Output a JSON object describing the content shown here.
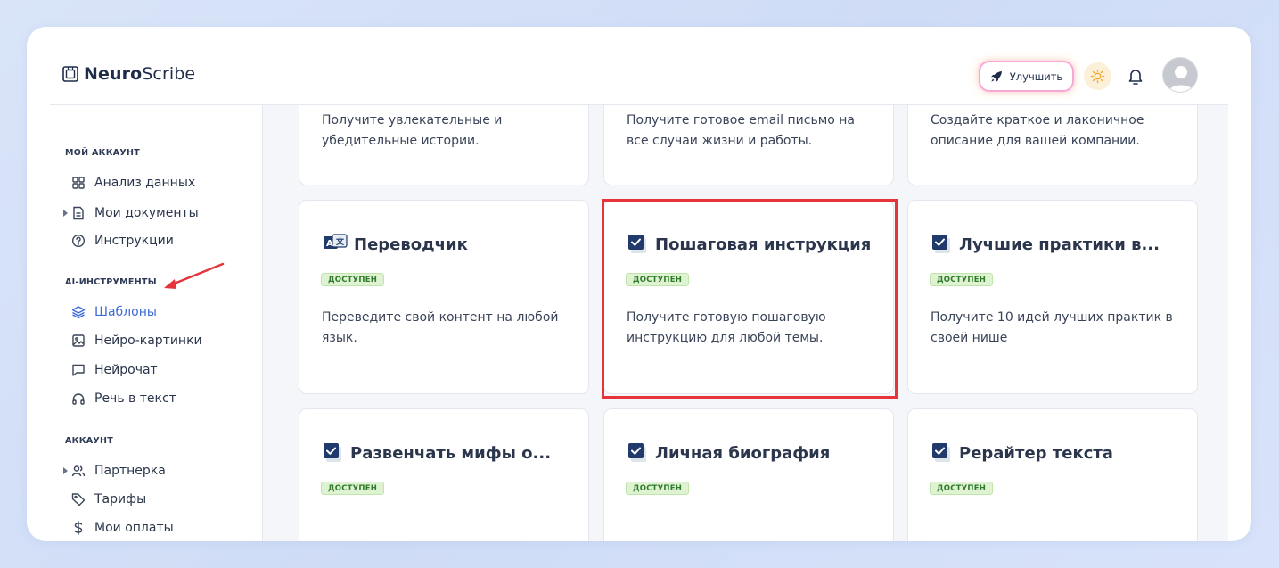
{
  "app": {
    "logo_bold": "Neuro",
    "logo_regular": "Scribe"
  },
  "header": {
    "upgrade_label": "Улучшить",
    "icons": [
      "rocket-icon",
      "sun-icon",
      "bell-icon",
      "avatar"
    ]
  },
  "sidebar": {
    "sections": [
      {
        "title": "МОЙ АККАУНТ",
        "items": [
          {
            "label": "Анализ данных",
            "icon": "grid-icon"
          },
          {
            "label": "Мои документы",
            "icon": "document-icon",
            "expandable": true
          },
          {
            "label": "Инструкции",
            "icon": "help-circle-icon"
          }
        ]
      },
      {
        "title": "AI-ИНСТРУМЕНТЫ",
        "items": [
          {
            "label": "Шаблоны",
            "icon": "layers-icon",
            "active": true
          },
          {
            "label": "Нейро-картинки",
            "icon": "image-icon"
          },
          {
            "label": "Нейрочат",
            "icon": "chat-icon"
          },
          {
            "label": "Речь в текст",
            "icon": "headphones-icon"
          }
        ]
      },
      {
        "title": "АККАУНТ",
        "items": [
          {
            "label": "Партнерка",
            "icon": "users-icon",
            "expandable": true
          },
          {
            "label": "Тарифы",
            "icon": "tag-icon"
          },
          {
            "label": "Мои оплаты",
            "icon": "dollar-icon"
          }
        ]
      }
    ]
  },
  "cards_top_partial": [
    {
      "desc": "Получите увлекательные и убедительные истории."
    },
    {
      "desc": "Получите готовое email письмо на все случаи жизни и работы."
    },
    {
      "desc": "Создайте краткое и лаконичное описание для вашей компании."
    }
  ],
  "cards": [
    {
      "title": "Переводчик",
      "badge": "ДОСТУПЕН",
      "desc": "Переведите свой контент на любой язык.",
      "icon": "translate-icon"
    },
    {
      "title": "Пошаговая инструкция",
      "badge": "ДОСТУПЕН",
      "desc": "Получите готовую пошаговую инструкцию для любой темы.",
      "icon": "checkbox-icon"
    },
    {
      "title": "Лучшие практики в...",
      "badge": "ДОСТУПЕН",
      "desc": "Получите 10 идей лучших практик в своей нише",
      "icon": "checkbox-icon"
    },
    {
      "title": "Развенчать мифы о...",
      "badge": "ДОСТУПЕН",
      "icon": "checkbox-icon"
    },
    {
      "title": "Личная биография",
      "badge": "ДОСТУПЕН",
      "icon": "checkbox-icon"
    },
    {
      "title": "Рерайтер текста",
      "badge": "ДОСТУПЕН",
      "icon": "checkbox-icon"
    }
  ],
  "colors": {
    "accent": "#3d6bd8",
    "highlight": "#e5343a",
    "badge_bg": "#dff3d3",
    "badge_text": "#2f7a2b"
  }
}
